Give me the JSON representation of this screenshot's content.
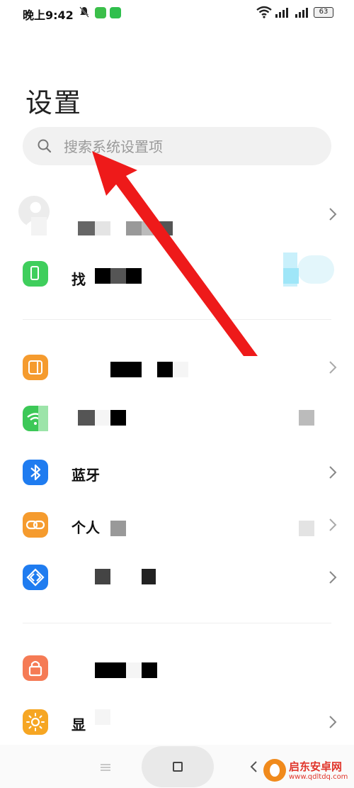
{
  "status_bar": {
    "time": "晚上9:42",
    "battery": "63",
    "icons": [
      "bell-off-icon",
      "app-icon",
      "wechat-icon",
      "wifi-icon",
      "signal-icon",
      "signal-icon",
      "battery-icon"
    ]
  },
  "page": {
    "title": "设置"
  },
  "search": {
    "placeholder": "搜索系统设置项",
    "icon": "search-icon"
  },
  "rows": [
    {
      "id": "account",
      "label": "",
      "icon": "avatar"
    },
    {
      "id": "find-device",
      "label": "找",
      "icon": "phone-icon",
      "icon_color": "#3fce5c"
    },
    {
      "id": "display-mode",
      "label": "",
      "icon": "square-icon",
      "icon_color": "#f59b2e"
    },
    {
      "id": "wlan",
      "label": "",
      "icon": "wifi-icon",
      "icon_color": "#3cc857"
    },
    {
      "id": "bluetooth",
      "label": "蓝牙",
      "icon": "bluetooth-icon",
      "icon_color": "#1f7cf0"
    },
    {
      "id": "hotspot",
      "label": "个人",
      "icon": "link-icon",
      "icon_color": "#f59b2e"
    },
    {
      "id": "connection",
      "label": "",
      "icon": "share-icon",
      "icon_color": "#1f7cf0"
    },
    {
      "id": "lock-screen",
      "label": "",
      "icon": "lock-icon",
      "icon_color": "#f57b55"
    },
    {
      "id": "display",
      "label": "显",
      "icon": "sun-icon",
      "icon_color": "#f6a623"
    }
  ],
  "watermark": {
    "name": "启东安卓网",
    "url": "www.qdltdq.com"
  },
  "annotation": {
    "arrow_color": "#ee1a1a"
  }
}
